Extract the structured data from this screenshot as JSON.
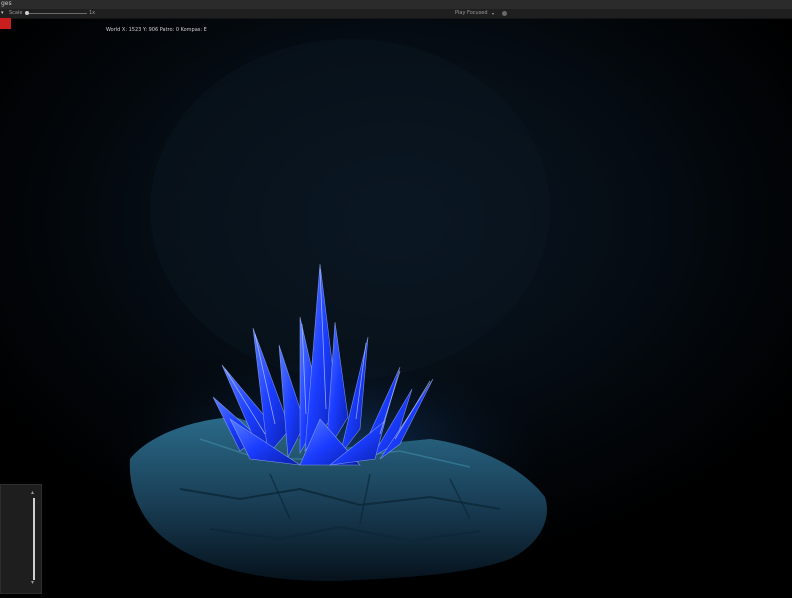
{
  "window": {
    "title": "ges"
  },
  "toolbar": {
    "display_arrow": "▾",
    "scale_label": "Scale",
    "scale_value": "1x",
    "play_mode": "Play Focused",
    "play_mode_arrow": "▾"
  },
  "hud": {
    "text": "World X: 1523 Y: 906 Patro: 0 Kompas: E"
  },
  "side_slider": {
    "up_arrow": "▴",
    "down_arrow": "▾"
  },
  "colors": {
    "crystal": "#1a3cff",
    "crystal_highlight": "#8aa8ff",
    "rock": "#1e4a63",
    "record_button": "#c81e1e"
  }
}
